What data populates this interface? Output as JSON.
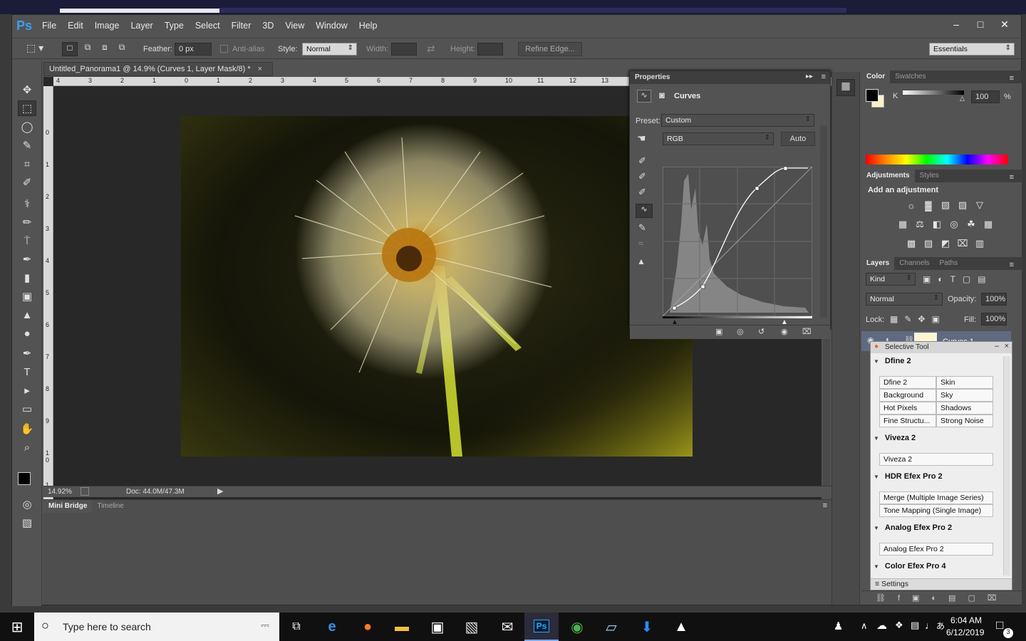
{
  "app": {
    "logo": "Ps"
  },
  "menu": [
    "File",
    "Edit",
    "Image",
    "Layer",
    "Type",
    "Select",
    "Filter",
    "3D",
    "View",
    "Window",
    "Help"
  ],
  "window_controls": {
    "minimize": "‒",
    "restore": "□",
    "close": "✕"
  },
  "options": {
    "feather_label": "Feather:",
    "feather_value": "0 px",
    "antialias_label": "Anti-alias",
    "style_label": "Style:",
    "style_value": "Normal",
    "width_label": "Width:",
    "height_label": "Height:",
    "refine_edge": "Refine Edge...",
    "workspace": "Essentials"
  },
  "document": {
    "tab_title": "Untitled_Panorama1 @ 14.9% (Curves 1, Layer Mask/8) *",
    "tab_close": "×",
    "zoom": "14.92%",
    "doc_size": "Doc: 44.0M/47.3M",
    "ruler_h": [
      "4",
      "3",
      "2",
      "1",
      "0",
      "1",
      "2",
      "3",
      "4",
      "5",
      "6",
      "7",
      "8",
      "9",
      "10",
      "11",
      "12",
      "13"
    ],
    "ruler_v": [
      "0",
      "1",
      "2",
      "3",
      "4",
      "5",
      "6",
      "7",
      "8",
      "9",
      "1 0",
      "1 1"
    ]
  },
  "bottom_tabs": {
    "mini_bridge": "Mini Bridge",
    "timeline": "Timeline"
  },
  "properties": {
    "title": "Properties",
    "adjustment": "Curves",
    "preset_label": "Preset:",
    "preset_value": "Custom",
    "channel": "RGB",
    "auto": "Auto"
  },
  "color_panel": {
    "tab_color": "Color",
    "tab_swatches": "Swatches",
    "channel_label": "K",
    "k_value": "100",
    "k_unit": "%",
    "k_level": 100
  },
  "adjustments_panel": {
    "tab_adjustments": "Adjustments",
    "tab_styles": "Styles",
    "heading": "Add an adjustment"
  },
  "layers_panel": {
    "tab_layers": "Layers",
    "tab_channels": "Channels",
    "tab_paths": "Paths",
    "filter_kind": "Kind",
    "blend_mode": "Normal",
    "opacity_label": "Opacity:",
    "opacity_value": "100%",
    "lock_label": "Lock:",
    "fill_label": "Fill:",
    "fill_value": "100%",
    "layer_name": "Curves 1"
  },
  "selective_tool": {
    "title": "Selective Tool",
    "groups": [
      {
        "name": "Dfine 2"
      },
      {
        "name": "Viveza 2"
      },
      {
        "name": "HDR Efex Pro 2"
      },
      {
        "name": "Analog Efex Pro 2"
      },
      {
        "name": "Color Efex Pro 4"
      }
    ],
    "dfine_buttons": [
      "Dfine 2",
      "Skin",
      "Background",
      "Sky",
      "Hot Pixels",
      "Shadows",
      "Fine Structu...",
      "Strong Noise"
    ],
    "viveza_button": "Viveza 2",
    "hdr_buttons": [
      "Merge (Multiple Image Series)",
      "Tone Mapping (Single Image)"
    ],
    "analog_button": "Analog Efex Pro 2",
    "settings": "Settings"
  },
  "taskbar": {
    "search_placeholder": "Type here to search",
    "time": "6:04 AM",
    "date": "6/12/2019",
    "notifications": "3"
  },
  "icons": {
    "windows": "⊞",
    "search": "○",
    "mic": "⎓",
    "taskview": "⧉",
    "edge": "e",
    "firefox": "●",
    "explorer": "▬",
    "store": "▣",
    "mail": "✉",
    "ps": "Ps",
    "chrome": "◉",
    "notepad": "▱",
    "download": "⬇",
    "photos": "▲",
    "person": "♟",
    "chevron": "∧",
    "cloud": "☁",
    "dropbox": "❖",
    "network": "▤",
    "volume": "♩",
    "ime": "あ",
    "notif": "□"
  },
  "colors": {
    "accent": "#3aa0f0",
    "taskbar": "#101010",
    "panel": "#535353"
  }
}
